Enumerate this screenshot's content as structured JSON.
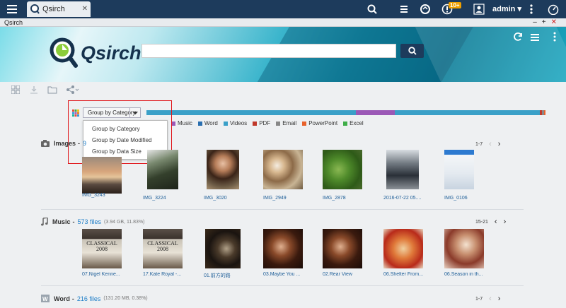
{
  "topbar": {
    "tab_label": "Qsirch",
    "notification_count": "10+",
    "user": "admin"
  },
  "window": {
    "title": "Qsirch"
  },
  "logo": {
    "text": "Qsirch"
  },
  "search": {
    "placeholder": "",
    "value": ""
  },
  "group_by": {
    "selected": "Group by Category",
    "options": [
      "Group by Category",
      "Group by Date Modified",
      "Group by Data Size"
    ]
  },
  "storage_bar": {
    "segments": [
      {
        "name": "Images",
        "color": "#3aa0c8",
        "fraction": 0.52
      },
      {
        "name": "Music",
        "color": "#9b59b6",
        "fraction": 0.095
      },
      {
        "name": "Word",
        "color": "#3aa0c8",
        "fraction": 0.16
      },
      {
        "name": "Videos",
        "color": "#3aa0c8",
        "fraction": 0.2
      },
      {
        "name": "PDF",
        "color": "#c0392b",
        "fraction": 0.006
      },
      {
        "name": "Email",
        "color": "#888888",
        "fraction": 0.005
      },
      {
        "name": "PowerPoint",
        "color": "#e8622c",
        "fraction": 0.004
      }
    ]
  },
  "legend": [
    {
      "label": "s",
      "color": "#3aa0c8"
    },
    {
      "label": "Music",
      "color": "#9b59b6"
    },
    {
      "label": "Word",
      "color": "#2a6fb0"
    },
    {
      "label": "Videos",
      "color": "#3aa0c8"
    },
    {
      "label": "PDF",
      "color": "#c0392b"
    },
    {
      "label": "Email",
      "color": "#888888"
    },
    {
      "label": "PowerPoint",
      "color": "#e8622c"
    },
    {
      "label": "Excel",
      "color": "#3fae49"
    }
  ],
  "sections": {
    "images": {
      "title": "Images",
      "count": "9",
      "pager": "1-7",
      "items": [
        "IMG_3243",
        "IMG_3224",
        "IMG_3020",
        "IMG_2949",
        "IMG_2878",
        "2016-07-22 05....",
        "IMG_0106"
      ]
    },
    "music": {
      "title": "Music",
      "count": "573 files",
      "meta": "(3.94 GB, 11.83%)",
      "pager": "15-21",
      "items": [
        "07.Nigel Kenne...",
        "17.Kate Royal -...",
        "01.前方的路",
        "03.Maybe You ...",
        "02.Rear View",
        "06.Shelter From...",
        "06.Season in th..."
      ],
      "album_text": "CLASSICAL 2008"
    },
    "word": {
      "title": "Word",
      "count": "216 files",
      "meta": "(131.20 MB, 0.38%)",
      "pager": "1-7"
    }
  }
}
